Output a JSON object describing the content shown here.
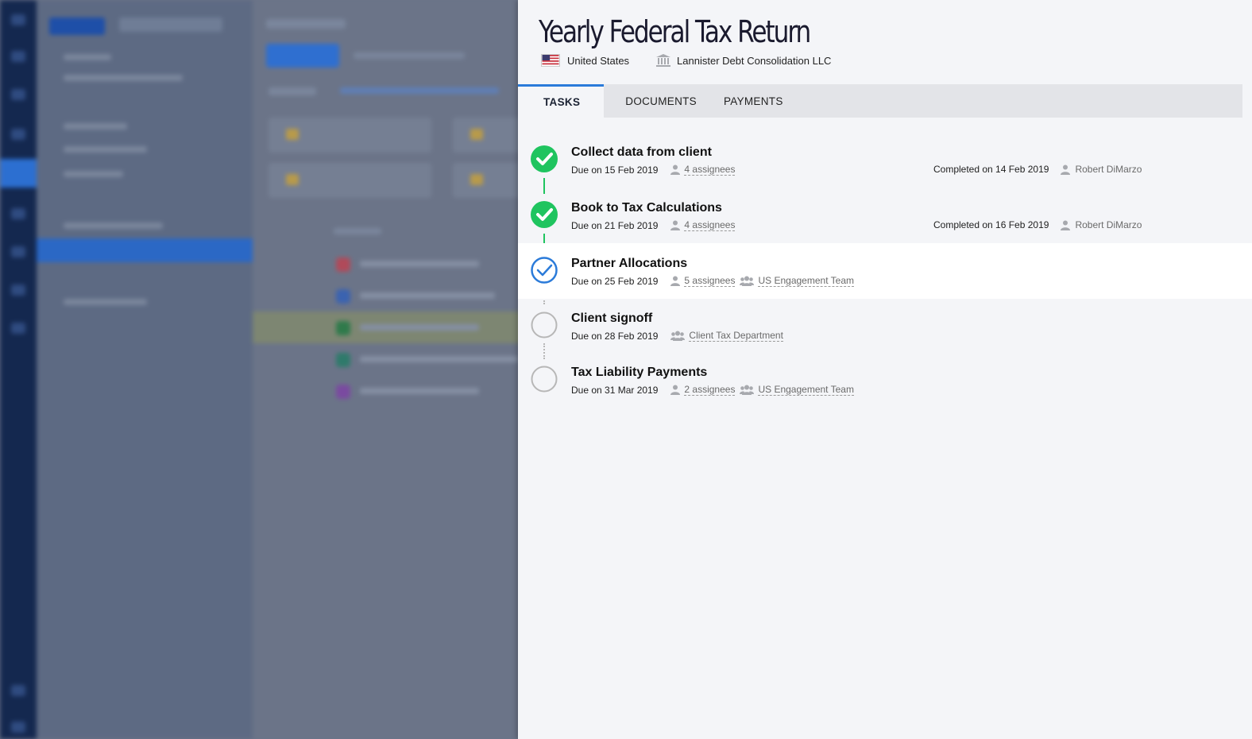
{
  "drawer": {
    "title": "Yearly Federal Tax Return",
    "country": "United States",
    "entity": "Lannister Debt Consolidation LLC"
  },
  "tabs": [
    {
      "label": "TASKS",
      "active": true
    },
    {
      "label": "DOCUMENTS",
      "active": false
    },
    {
      "label": "PAYMENTS",
      "active": false
    }
  ],
  "tasks": [
    {
      "name": "Collect data from client",
      "due": "Due on 15 Feb 2019",
      "assignees": "4 assignees",
      "team": null,
      "status": "completed",
      "completed": "Completed on 14 Feb 2019",
      "completed_by": "Robert DiMarzo"
    },
    {
      "name": "Book to Tax Calculations",
      "due": "Due on 21 Feb 2019",
      "assignees": "4 assignees",
      "team": null,
      "status": "completed",
      "completed": "Completed on 16 Feb 2019",
      "completed_by": "Robert DiMarzo"
    },
    {
      "name": "Partner Allocations",
      "due": "Due on 25 Feb 2019",
      "assignees": "5 assignees",
      "team": "US Engagement Team",
      "status": "in-progress"
    },
    {
      "name": "Client signoff",
      "due": "Due on 28 Feb 2019",
      "assignees": null,
      "team": "Client Tax Department",
      "status": "pending"
    },
    {
      "name": "Tax Liability Payments",
      "due": "Due on 31 Mar 2019",
      "assignees": "2 assignees",
      "team": "US Engagement Team",
      "status": "pending"
    }
  ],
  "colors": {
    "accent": "#2b7bd9",
    "complete": "#1fc45f",
    "pending": "#b7b7b7"
  }
}
